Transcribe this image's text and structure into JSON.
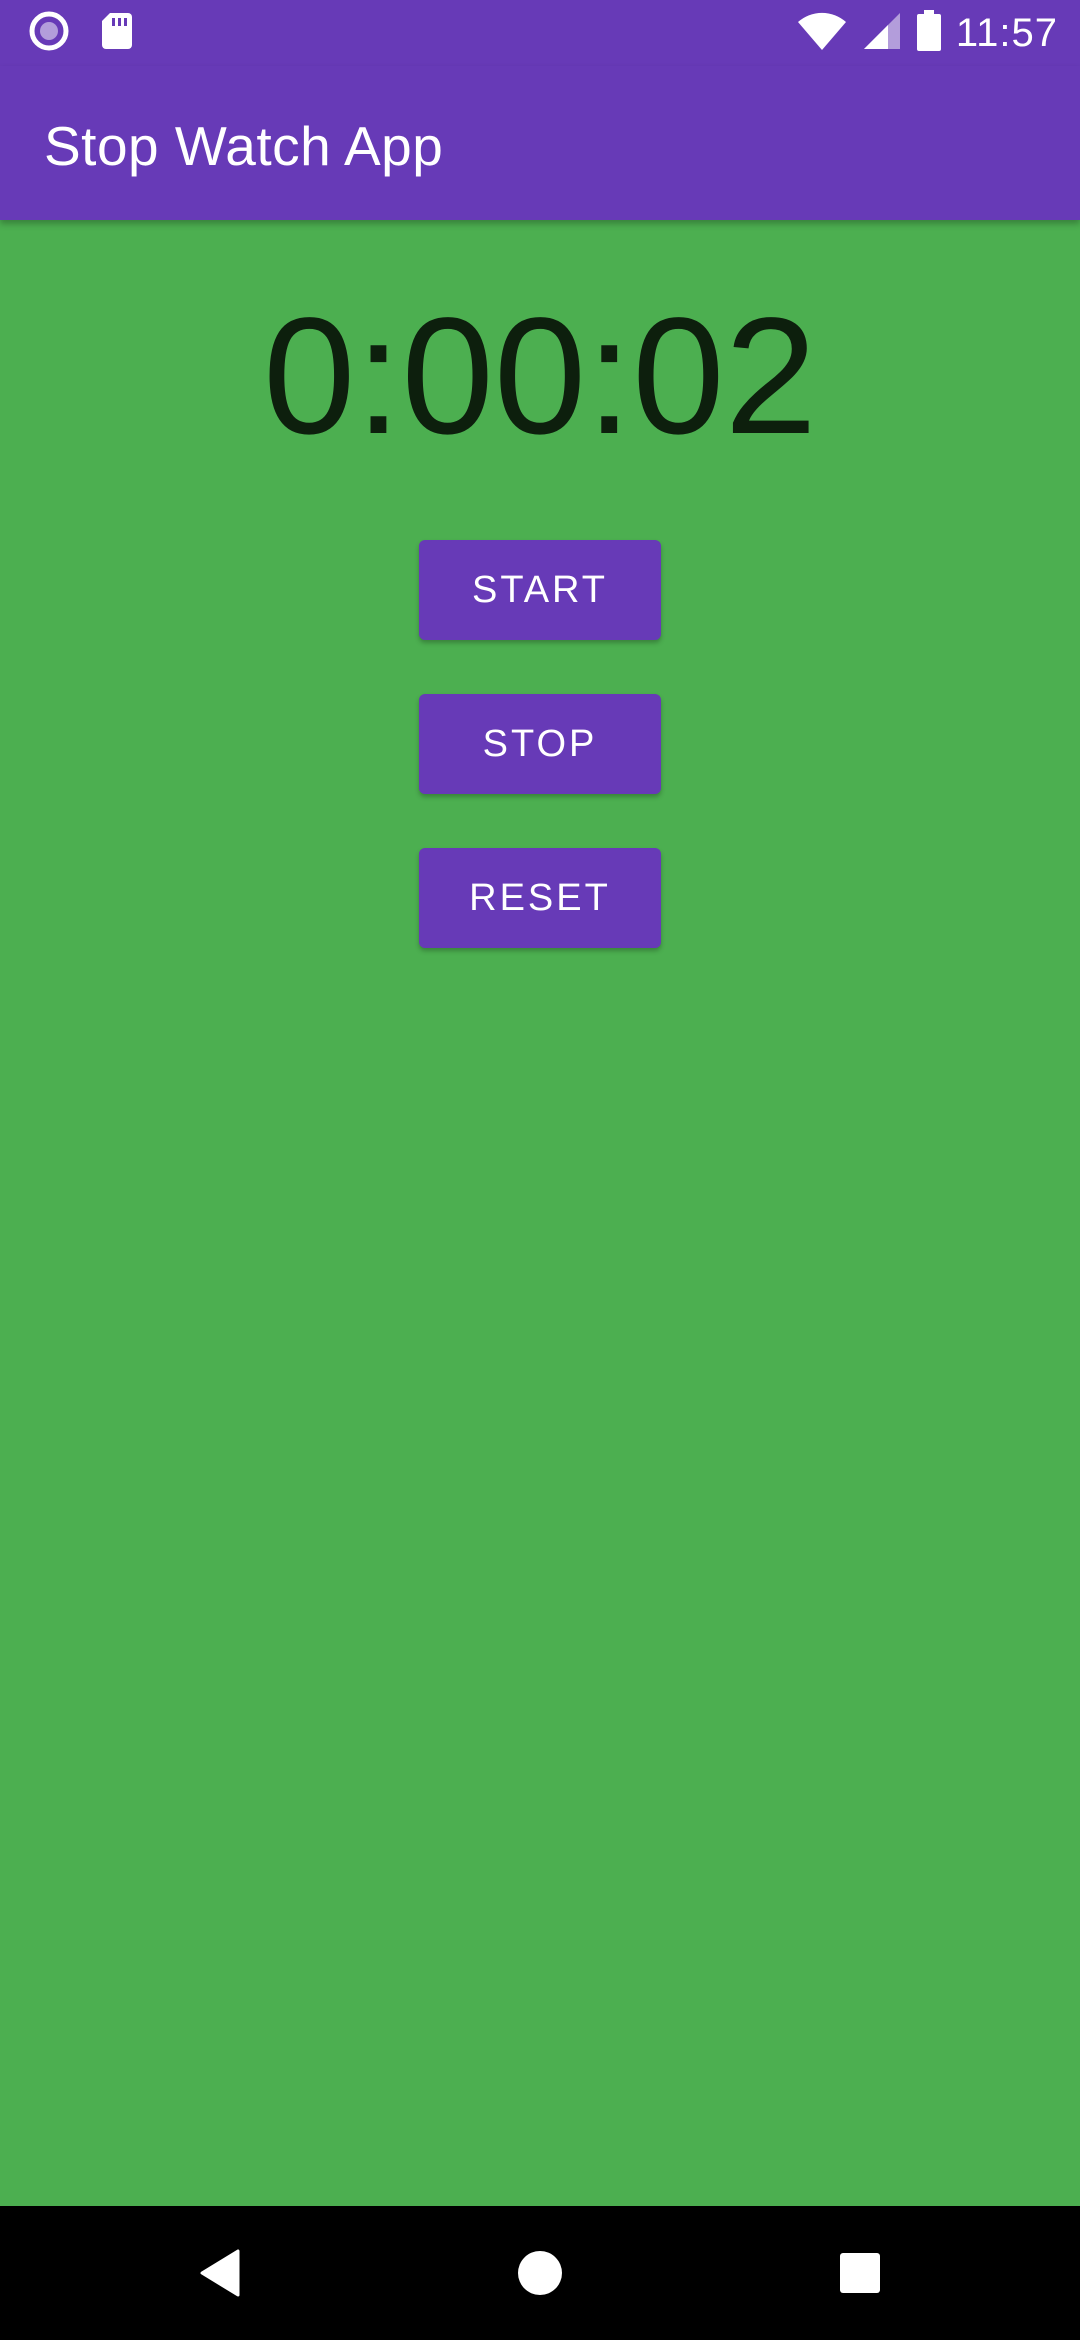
{
  "status_bar": {
    "time": "11:57",
    "left_icons": [
      "radio-icon",
      "sd-card-icon"
    ],
    "right_icons": [
      "wifi-icon",
      "signal-icon",
      "battery-icon"
    ]
  },
  "app_bar": {
    "title": "Stop Watch App"
  },
  "timer": {
    "value": "0:00:02"
  },
  "buttons": {
    "start_label": "START",
    "stop_label": "STOP",
    "reset_label": "RESET"
  },
  "nav_bar": {
    "icons": [
      "back-icon",
      "home-icon",
      "recent-apps-icon"
    ]
  },
  "colors": {
    "primary": "#673ab7",
    "background": "#4caf50",
    "timer_text": "#0d1f0d",
    "nav_bar": "#000000"
  }
}
